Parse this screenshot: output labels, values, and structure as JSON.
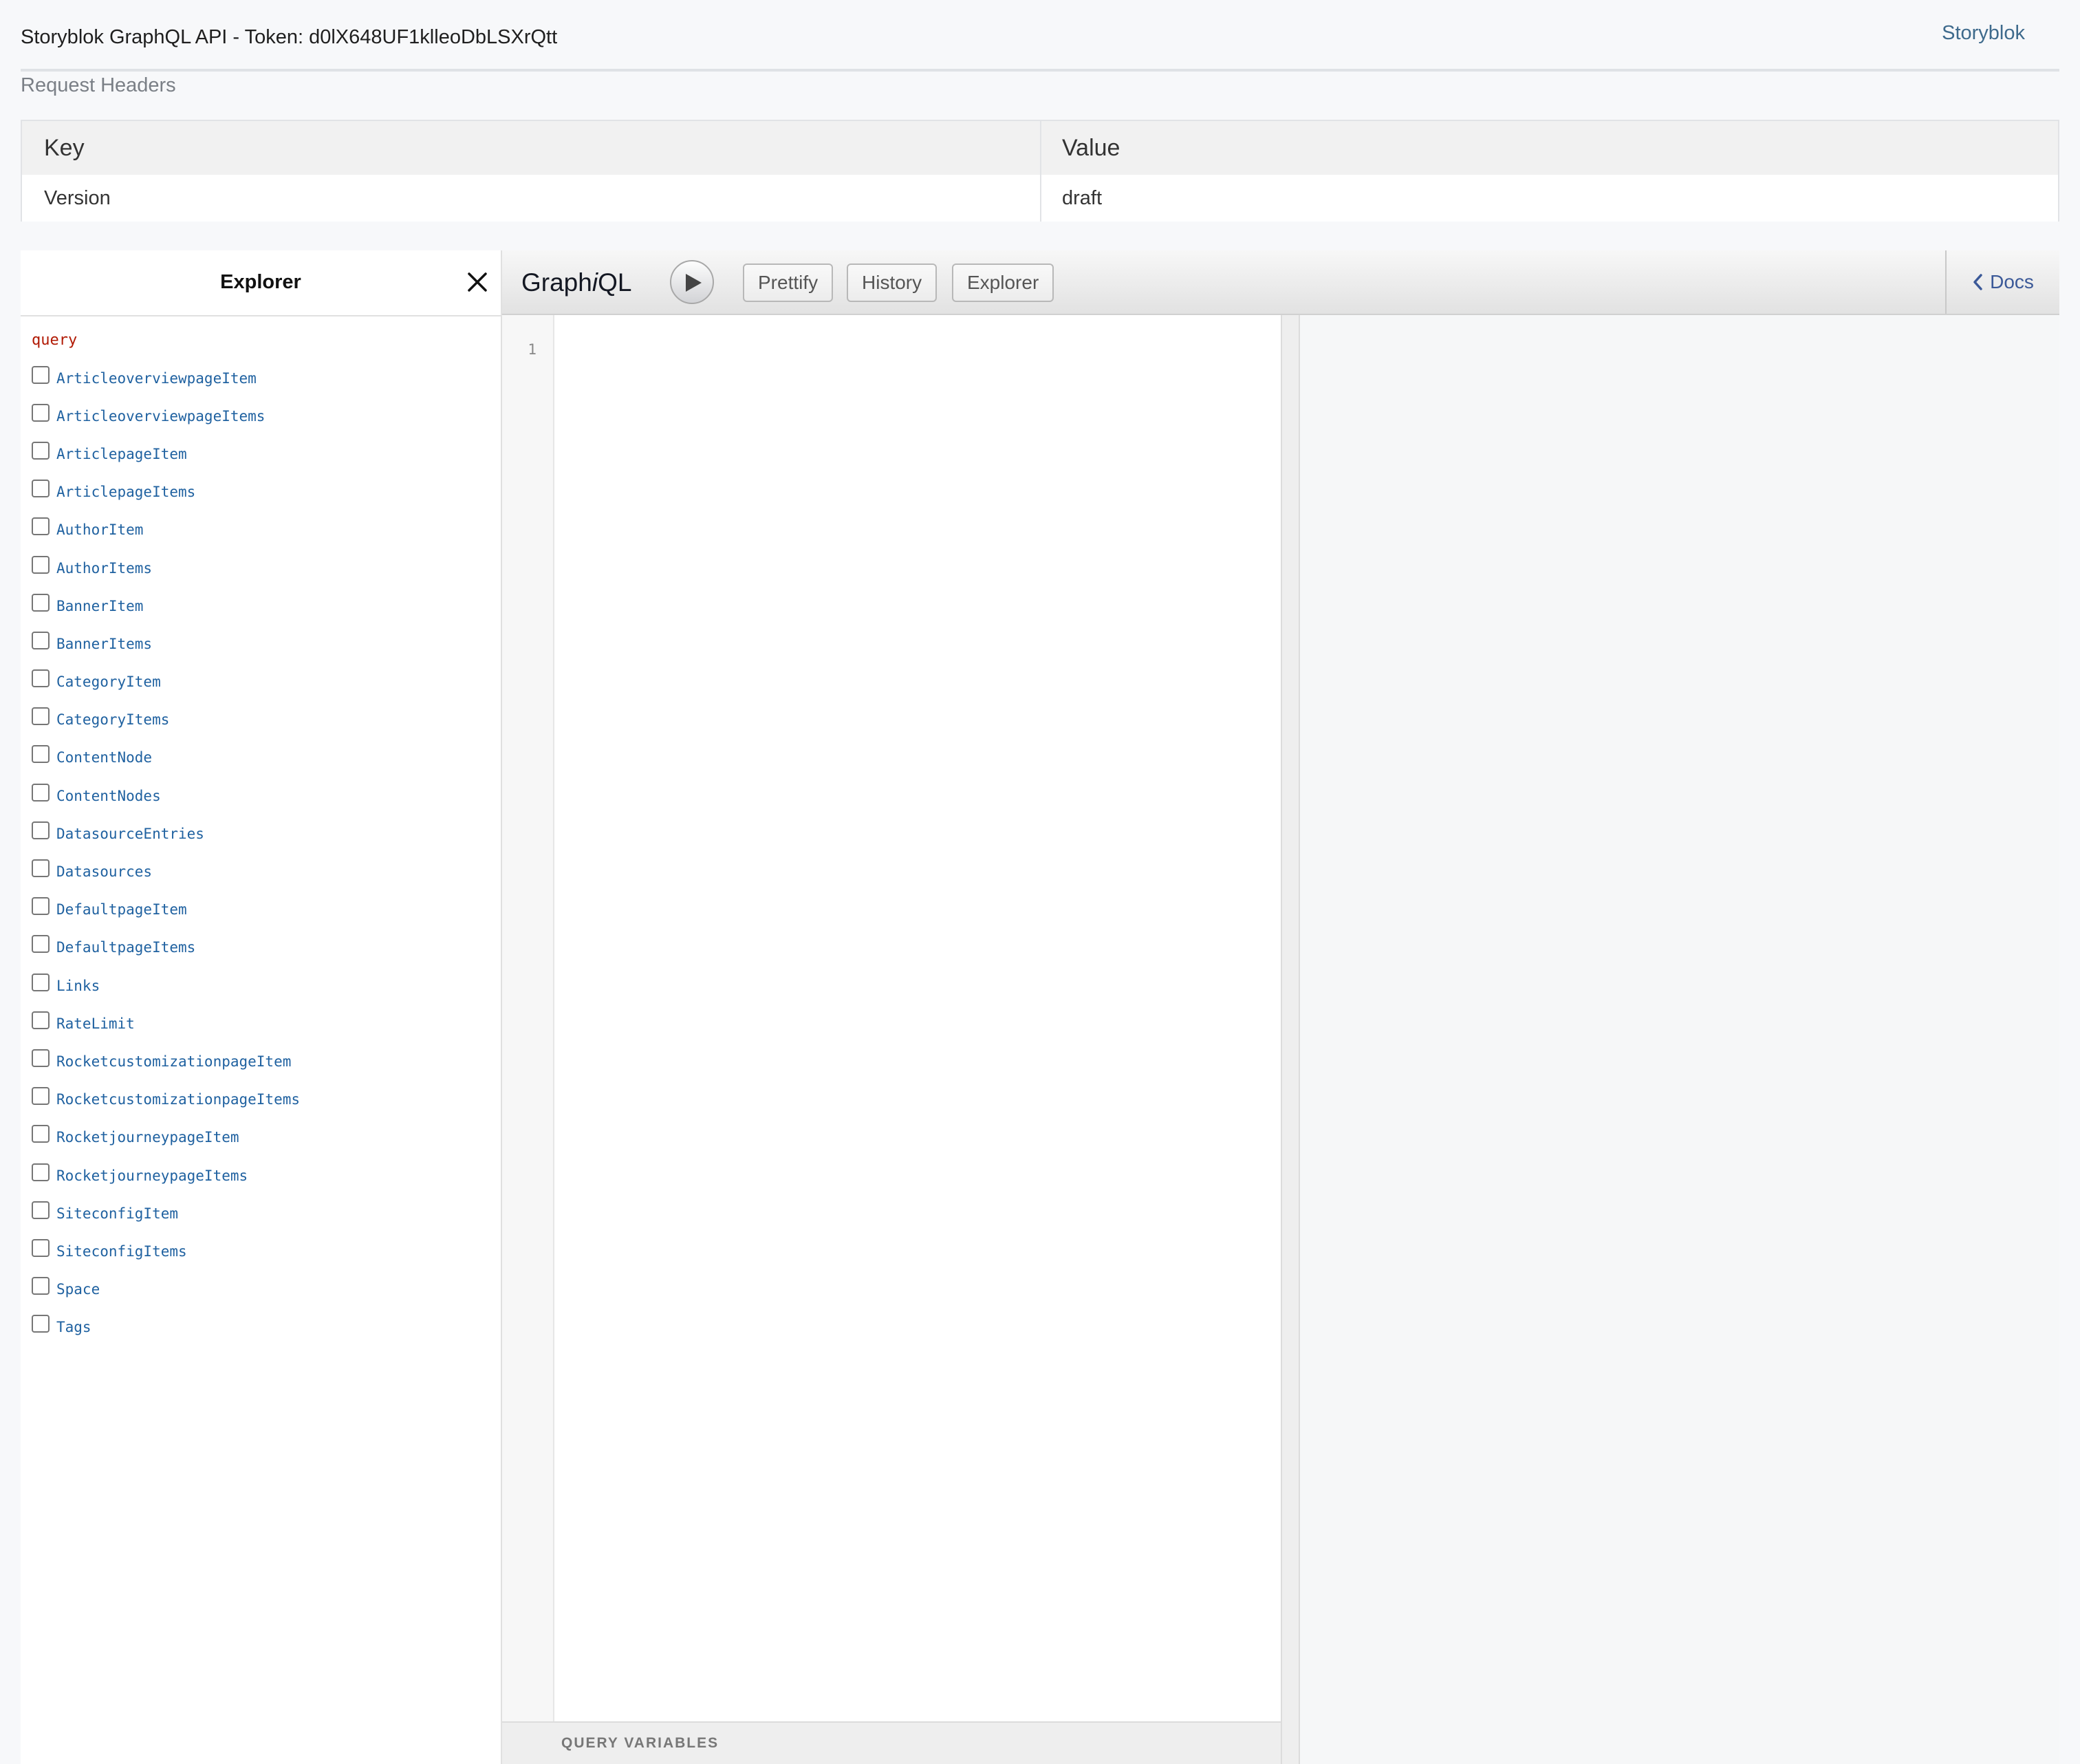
{
  "header": {
    "title": "Storyblok GraphQL API - Token: d0lX648UF1klleoDbLSXrQtt",
    "link_label": "Storyblok"
  },
  "request_headers": {
    "label": "Request Headers",
    "columns": [
      "Key",
      "Value"
    ],
    "rows": [
      {
        "key": "Version",
        "value": "draft"
      }
    ]
  },
  "explorer": {
    "title": "Explorer",
    "close_icon": "close-icon",
    "operation_keyword": "query",
    "fields": [
      "ArticleoverviewpageItem",
      "ArticleoverviewpageItems",
      "ArticlepageItem",
      "ArticlepageItems",
      "AuthorItem",
      "AuthorItems",
      "BannerItem",
      "BannerItems",
      "CategoryItem",
      "CategoryItems",
      "ContentNode",
      "ContentNodes",
      "DatasourceEntries",
      "Datasources",
      "DefaultpageItem",
      "DefaultpageItems",
      "Links",
      "RateLimit",
      "RocketcustomizationpageItem",
      "RocketcustomizationpageItems",
      "RocketjourneypageItem",
      "RocketjourneypageItems",
      "SiteconfigItem",
      "SiteconfigItems",
      "Space",
      "Tags"
    ]
  },
  "graphiql": {
    "title_prefix": "Graph",
    "title_italic": "i",
    "title_suffix": "QL",
    "run_icon": "play-icon",
    "buttons": {
      "prettify": "Prettify",
      "history": "History",
      "explorer": "Explorer"
    },
    "docs_label": "Docs",
    "editor_line_numbers": [
      "1"
    ],
    "query_variables_label": "QUERY VARIABLES"
  }
}
